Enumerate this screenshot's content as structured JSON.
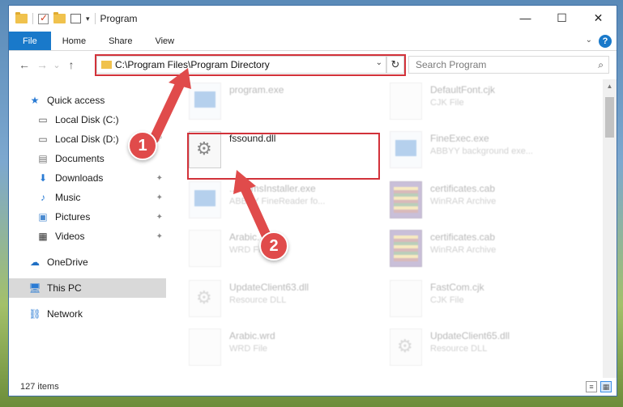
{
  "window": {
    "title": "Program",
    "controls": {
      "minimize": "—",
      "maximize": "☐",
      "close": "✕"
    }
  },
  "ribbon": {
    "tabs": [
      {
        "label": "File"
      },
      {
        "label": "Home"
      },
      {
        "label": "Share"
      },
      {
        "label": "View"
      }
    ],
    "help": "?"
  },
  "nav": {
    "back": "←",
    "forward": "→",
    "recent": "⌄",
    "up": "↑",
    "address": "C:\\Program Files\\Program Directory",
    "search_placeholder": "Search Program",
    "refresh": "↻"
  },
  "sidebar": {
    "items": [
      {
        "label": "Quick access",
        "icon": "star-icon"
      },
      {
        "label": "Local Disk (C:)",
        "icon": "drive-icon"
      },
      {
        "label": "Local Disk (D:)",
        "icon": "drive-icon"
      },
      {
        "label": "Documents",
        "icon": "documents-icon"
      },
      {
        "label": "Downloads",
        "icon": "download-icon"
      },
      {
        "label": "Music",
        "icon": "music-icon"
      },
      {
        "label": "Pictures",
        "icon": "pictures-icon"
      },
      {
        "label": "Videos",
        "icon": "videos-icon"
      },
      {
        "label": "OneDrive",
        "icon": "cloud-icon"
      },
      {
        "label": "This PC",
        "icon": "computer-icon"
      },
      {
        "label": "Network",
        "icon": "network-icon"
      }
    ]
  },
  "files": {
    "program_exe": {
      "name": "program.exe",
      "type": ""
    },
    "default_font": {
      "name": "DefaultFont.cjk",
      "type": "CJK File"
    },
    "fssound": {
      "name": "fssound.dll",
      "type": ""
    },
    "fineexec": {
      "name": "FineExec.exe",
      "type": "ABBYY background exe..."
    },
    "installer": {
      "name": "...emmsInstaller.exe",
      "type": "ABBYY FineReader fo..."
    },
    "certificates1": {
      "name": "certificates.cab",
      "type": "WinRAR Archive"
    },
    "arabic1": {
      "name": "Arabic...",
      "type": "WRD File"
    },
    "certificates2": {
      "name": "certificates.cab",
      "type": "WinRAR Archive"
    },
    "update63": {
      "name": "UpdateClient63.dll",
      "type": "Resource DLL"
    },
    "fastcom": {
      "name": "FastCom.cjk",
      "type": "CJK File"
    },
    "arabic2": {
      "name": "Arabic.wrd",
      "type": "WRD File"
    },
    "update65": {
      "name": "UpdateClient65.dll",
      "type": "Resource DLL"
    }
  },
  "status": {
    "items": "127 items"
  },
  "callouts": {
    "one": "1",
    "two": "2"
  },
  "colors": {
    "accent": "#1979ca",
    "highlight": "#d2323a",
    "callout": "#e04b4b"
  }
}
